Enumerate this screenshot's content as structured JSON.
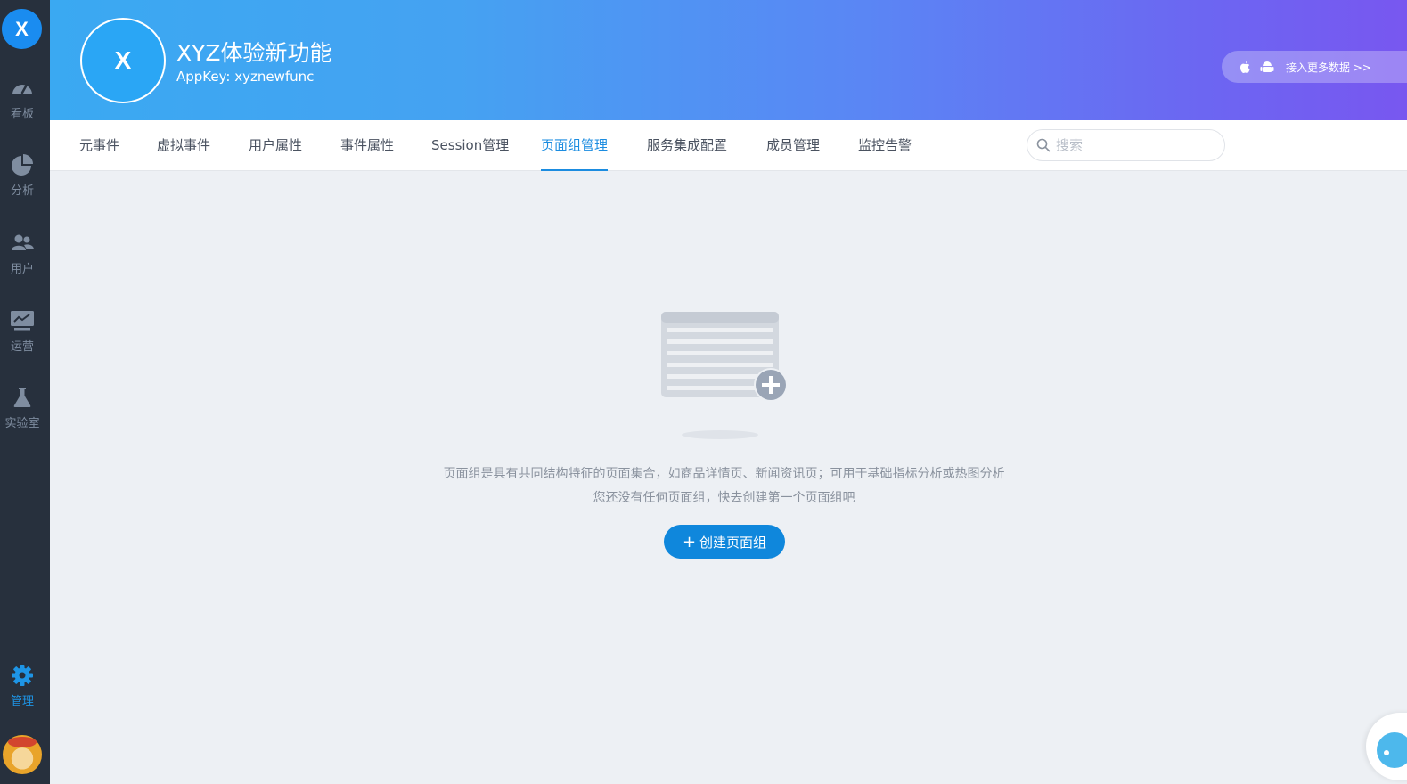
{
  "sidebar": {
    "logo": "X",
    "items": [
      {
        "label": "看板",
        "icon": "dashboard-icon"
      },
      {
        "label": "分析",
        "icon": "pie-chart-icon"
      },
      {
        "label": "用户",
        "icon": "users-icon"
      },
      {
        "label": "运营",
        "icon": "monitor-chart-icon"
      },
      {
        "label": "实验室",
        "icon": "flask-icon"
      }
    ],
    "bottom_item": {
      "label": "管理",
      "icon": "gear-icon"
    },
    "avatar_icon": "user-avatar"
  },
  "header": {
    "app_logo": "X",
    "title": "XYZ体验新功能",
    "appkey": "AppKey: xyznewfunc",
    "more_data_label": "接入更多数据 >>",
    "more_data_icons": [
      "apple-icon",
      "android-icon"
    ]
  },
  "tabs": [
    {
      "label": "元事件"
    },
    {
      "label": "虚拟事件"
    },
    {
      "label": "用户属性"
    },
    {
      "label": "事件属性"
    },
    {
      "label": "Session管理"
    },
    {
      "label": "页面组管理",
      "active": true
    },
    {
      "label": "服务集成配置"
    },
    {
      "label": "成员管理"
    },
    {
      "label": "监控告警"
    }
  ],
  "search": {
    "placeholder": "搜索",
    "value": ""
  },
  "empty_state": {
    "illustration": "page-group-add-icon",
    "desc_line1": "页面组是具有共同结构特征的页面集合，如商品详情页、新闻资讯页；可用于基础指标分析或热图分析",
    "desc_line2": "您还没有任何页面组，快去创建第一个页面组吧",
    "create_button": "创建页面组"
  },
  "colors": {
    "sidebar_bg": "#27303d",
    "accent": "#1b8ce0",
    "banner_start": "#3aa9f2",
    "banner_end": "#7857f0",
    "page_bg": "#edf0f4"
  }
}
